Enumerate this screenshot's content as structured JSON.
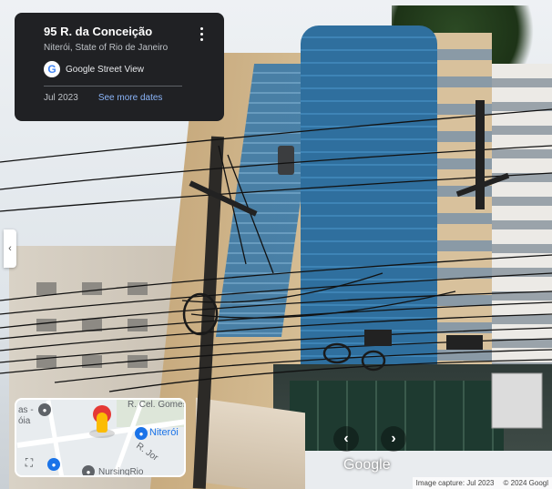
{
  "info_card": {
    "title": "95 R. da Conceição",
    "subtitle": "Niterói, State of Rio de Janeiro",
    "service": "Google Street View",
    "date": "Jul 2023",
    "more_dates": "See more dates"
  },
  "minimap": {
    "street_label": "R. Cel. Gomes",
    "city_label": "Niterói",
    "poi_label": "NursingRio",
    "left_label_1": "as -",
    "left_label_2": "óia",
    "street_label_2": "R. Jor"
  },
  "watermark": "Google",
  "footer": {
    "capture": "Image capture: Jul 2023",
    "copyright": "© 2024 Googl"
  },
  "colors": {
    "card_bg": "#202124",
    "link": "#8ab4f8",
    "map_accent": "#1a73e8",
    "pin": "#e53935",
    "pegman": "#fbbc04"
  },
  "icons": {
    "menu": "kebab-icon",
    "logo": "google-g-icon",
    "expand": "expand-icon",
    "prev": "chevron-left-icon",
    "next": "chevron-right-icon"
  }
}
